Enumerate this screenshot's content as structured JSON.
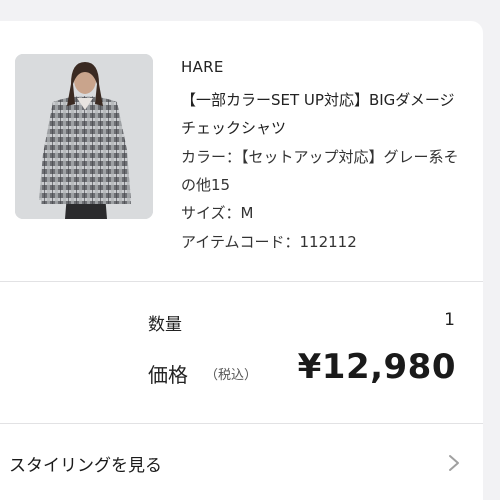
{
  "product": {
    "image_icon": "product-photo-plaid-shirt",
    "brand": "HARE",
    "name": "【一部カラーSET UP対応】BIGダメージチェックシャツ",
    "color_line": "カラー：【セットアップ対応】グレー系その他15",
    "size_line": "サイズ：M",
    "code_line": "アイテムコード：112112"
  },
  "summary": {
    "quantity_label": "数量",
    "quantity_value": "1",
    "price_label": "価格",
    "tax_note": "（税込）",
    "price_value": "¥12,980"
  },
  "styling_link": {
    "label": "スタイリングを見る",
    "icon": "chevron-right-icon"
  },
  "colors": {
    "background": "#f2f2f4",
    "card": "#ffffff",
    "divider": "#e2e2e4",
    "chevron": "#a0a0a0"
  }
}
